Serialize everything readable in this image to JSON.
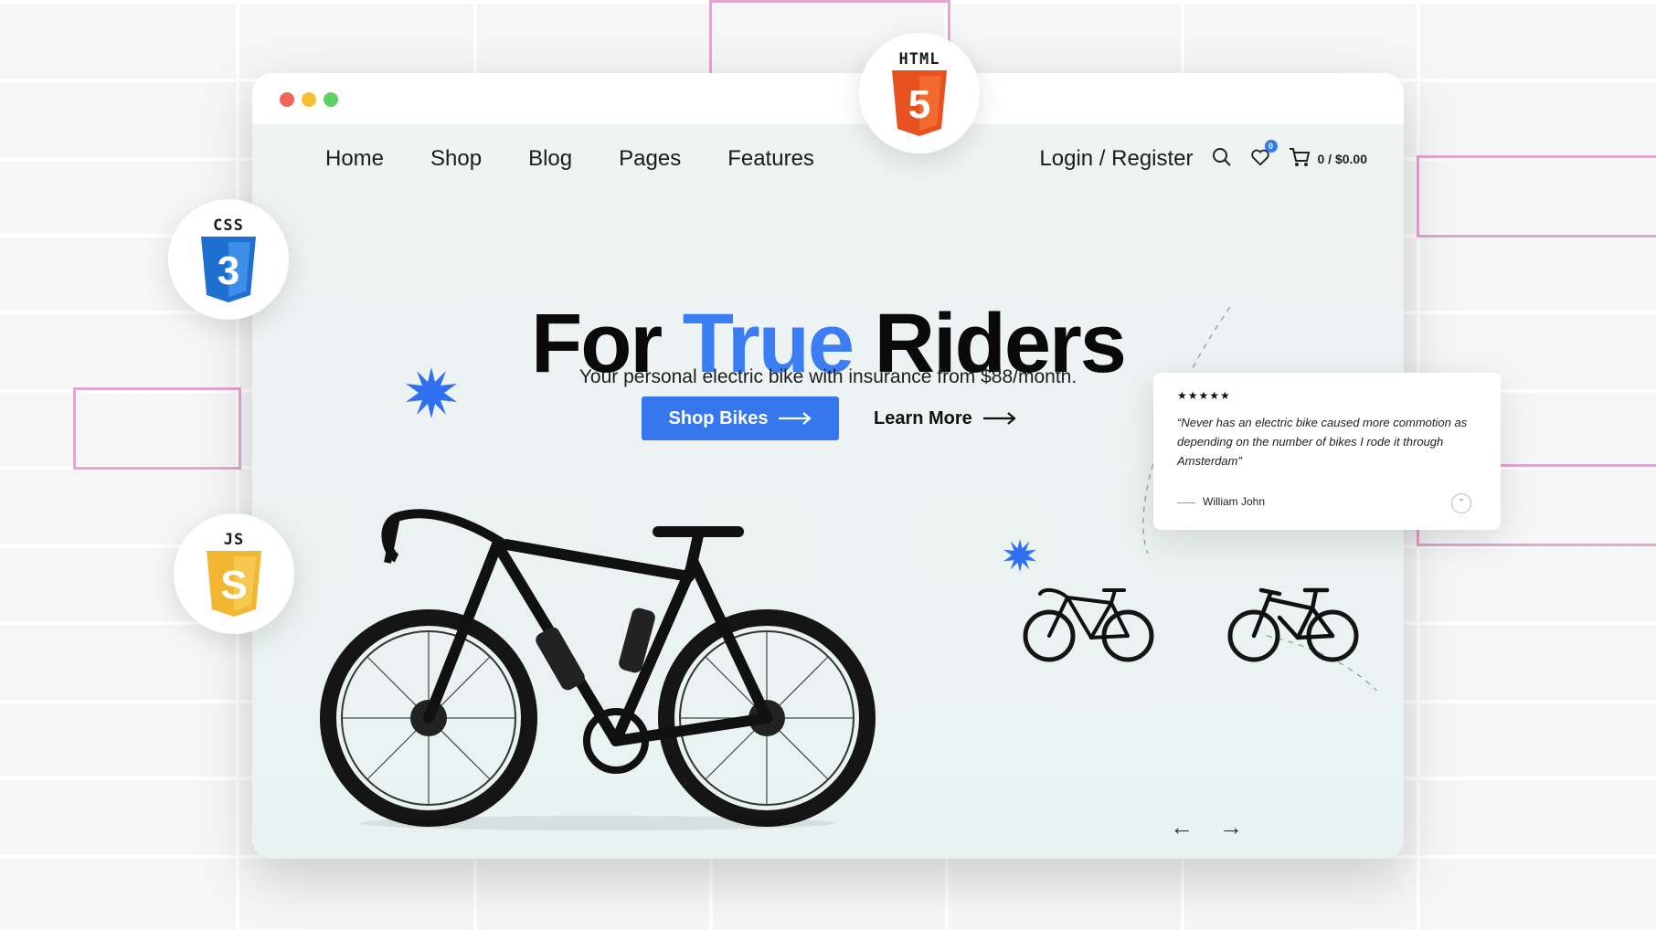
{
  "nav": {
    "items": [
      {
        "label": "Home"
      },
      {
        "label": "Shop"
      },
      {
        "label": "Blog"
      },
      {
        "label": "Pages"
      },
      {
        "label": "Features"
      }
    ],
    "login_label": "Login / Register",
    "wishlist_count": "0",
    "cart_total": "0 / $0.00"
  },
  "hero": {
    "title_part1": "For",
    "title_accent": "True",
    "title_part2": "Riders",
    "subtitle": "Your personal electric bike with insurance from $88/month.",
    "primary_button": "Shop Bikes",
    "secondary_link": "Learn More"
  },
  "testimonial": {
    "stars": "★★★★★",
    "quote": "“Never has an electric bike caused more commotion as depending on the number of bikes I rode it through Amsterdam”",
    "author": "William John",
    "quote_mark": "”"
  },
  "slider": {
    "prev": "←",
    "next": "→"
  },
  "tech_badges": {
    "html": "HTML",
    "html_version": "5",
    "css": "CSS",
    "css_version": "3",
    "js": "JS",
    "js_version": "S"
  },
  "colors": {
    "accent": "#3b7df3",
    "button": "#3578ee",
    "html_orange": "#e7501f",
    "css_blue": "#1f6fd1",
    "js_yellow": "#f1b733",
    "dot_red": "#f06757",
    "dot_yellow": "#f4c02e",
    "dot_green": "#5fd062"
  }
}
